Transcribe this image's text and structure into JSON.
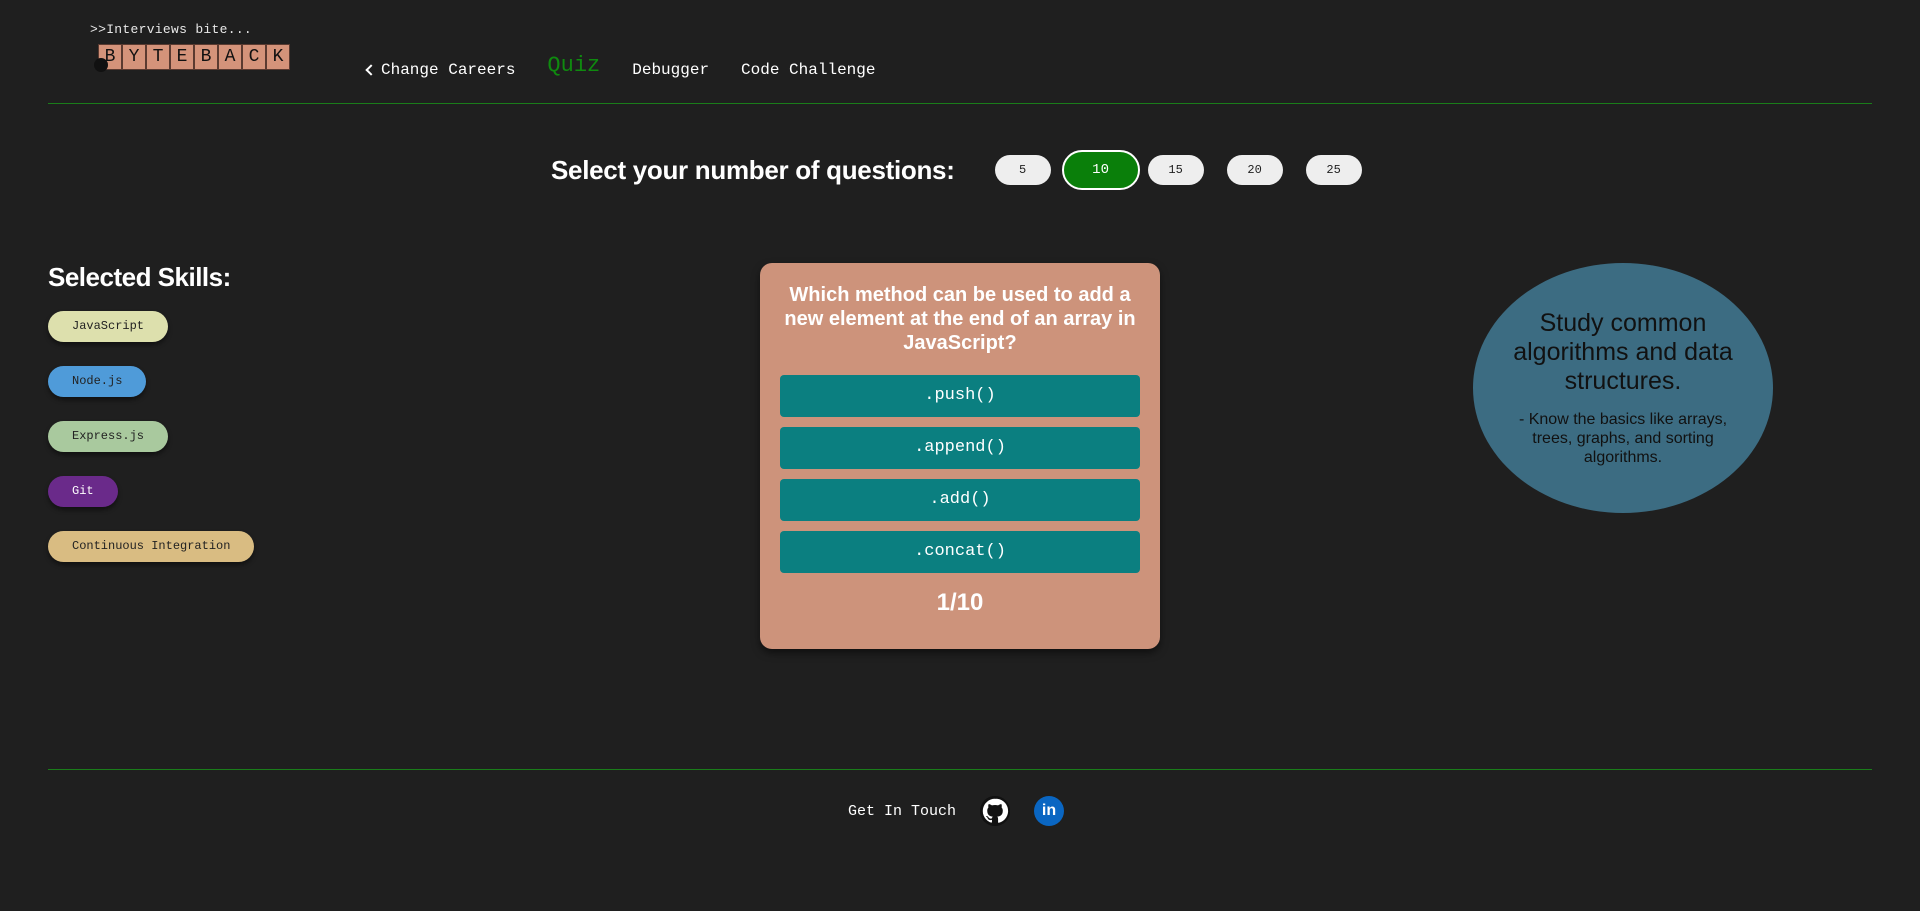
{
  "header": {
    "tagline": ">>Interviews bite...",
    "logo_letters": [
      "B",
      "Y",
      "T",
      "E",
      "B",
      "A",
      "C",
      "K"
    ],
    "nav": [
      {
        "label": "Change Careers",
        "icon": "chevron-left-icon"
      },
      {
        "label": "Quiz",
        "active": true
      },
      {
        "label": "Debugger"
      },
      {
        "label": "Code Challenge"
      }
    ]
  },
  "question_count": {
    "label": "Select your number of questions:",
    "options": [
      "5",
      "10",
      "15",
      "20",
      "25"
    ],
    "selected": "10"
  },
  "skills": {
    "title": "Selected Skills:",
    "items": [
      {
        "label": "JavaScript",
        "bg": "#dde0ad",
        "fg": "#222222"
      },
      {
        "label": "Node.js",
        "bg": "#4f9bd9",
        "fg": "#222222"
      },
      {
        "label": "Express.js",
        "bg": "#a9c99e",
        "fg": "#222222"
      },
      {
        "label": "Git",
        "bg": "#6a2a8a",
        "fg": "#ffffff"
      },
      {
        "label": "Continuous Integration",
        "bg": "#d9bc82",
        "fg": "#222222"
      }
    ]
  },
  "quiz": {
    "question": "Which method can be used to add a new element at the end of an array in JavaScript?",
    "answers": [
      ".push()",
      ".append()",
      ".add()",
      ".concat()"
    ],
    "progress": "1/10"
  },
  "tip": {
    "title": "Study common algorithms and data structures.",
    "body": "- Know the basics like arrays, trees, graphs, and sorting algorithms."
  },
  "footer": {
    "label": "Get In Touch",
    "icons": [
      "github-icon",
      "linkedin-icon"
    ],
    "linkedin_text": "in"
  },
  "colors": {
    "background": "#1f1f1f",
    "accent_green": "#0a7f0a",
    "card": "#cd937b",
    "answer": "#0b7f80",
    "tip": "#3c6c82"
  }
}
